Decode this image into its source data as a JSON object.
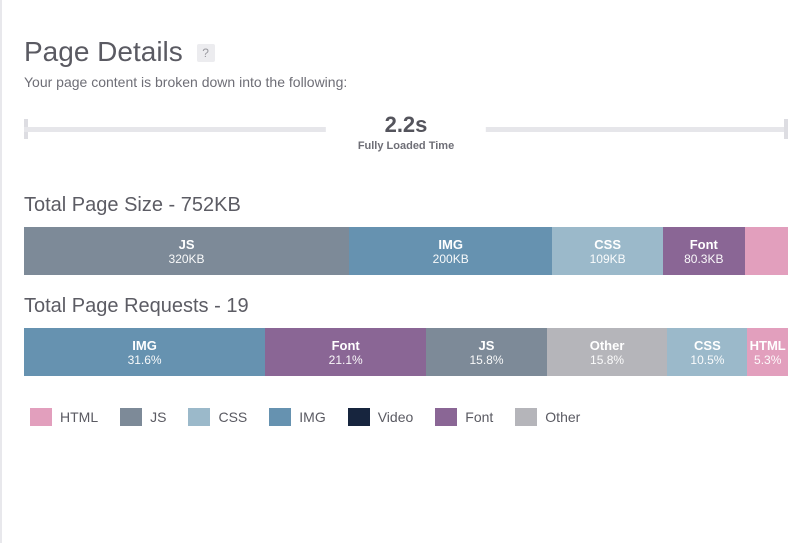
{
  "header": {
    "title": "Page Details",
    "help_glyph": "?",
    "subtitle": "Your page content is broken down into the following:"
  },
  "fully_loaded": {
    "value": "2.2s",
    "label": "Fully Loaded Time"
  },
  "size_section": {
    "title": "Total Page Size - 752KB"
  },
  "requests_section": {
    "title": "Total Page Requests - 19"
  },
  "colors": {
    "HTML": "#e29fbd",
    "JS": "#7d8a98",
    "CSS": "#9bb9ca",
    "IMG": "#6692b0",
    "Video": "#17253e",
    "Font": "#8a6695",
    "Other": "#b5b5ba"
  },
  "legend": [
    {
      "key": "HTML",
      "label": "HTML"
    },
    {
      "key": "JS",
      "label": "JS"
    },
    {
      "key": "CSS",
      "label": "CSS"
    },
    {
      "key": "IMG",
      "label": "IMG"
    },
    {
      "key": "Video",
      "label": "Video"
    },
    {
      "key": "Font",
      "label": "Font"
    },
    {
      "key": "Other",
      "label": "Other"
    }
  ],
  "chart_data": [
    {
      "type": "bar",
      "title": "Total Page Size - 752KB",
      "xlabel": "",
      "ylabel": "",
      "orientation": "horizontal-stacked",
      "unit": "KB",
      "total": 752,
      "series": [
        {
          "name": "JS",
          "value": 320,
          "label": "320KB",
          "show_label": true
        },
        {
          "name": "IMG",
          "value": 200,
          "label": "200KB",
          "show_label": true
        },
        {
          "name": "CSS",
          "value": 109,
          "label": "109KB",
          "show_label": true
        },
        {
          "name": "Font",
          "value": 80.3,
          "label": "80.3KB",
          "show_label": true
        },
        {
          "name": "HTML",
          "value": 42.7,
          "label": "",
          "show_label": false
        }
      ]
    },
    {
      "type": "bar",
      "title": "Total Page Requests - 19",
      "xlabel": "",
      "ylabel": "",
      "orientation": "horizontal-stacked",
      "unit": "%",
      "total": 100,
      "series": [
        {
          "name": "IMG",
          "value": 31.6,
          "label": "31.6%",
          "show_label": true
        },
        {
          "name": "Font",
          "value": 21.1,
          "label": "21.1%",
          "show_label": true
        },
        {
          "name": "JS",
          "value": 15.8,
          "label": "15.8%",
          "show_label": true
        },
        {
          "name": "Other",
          "value": 15.8,
          "label": "15.8%",
          "show_label": true
        },
        {
          "name": "CSS",
          "value": 10.5,
          "label": "10.5%",
          "show_label": true
        },
        {
          "name": "HTML",
          "value": 5.3,
          "label": "5.3%",
          "show_label": true
        }
      ]
    }
  ]
}
